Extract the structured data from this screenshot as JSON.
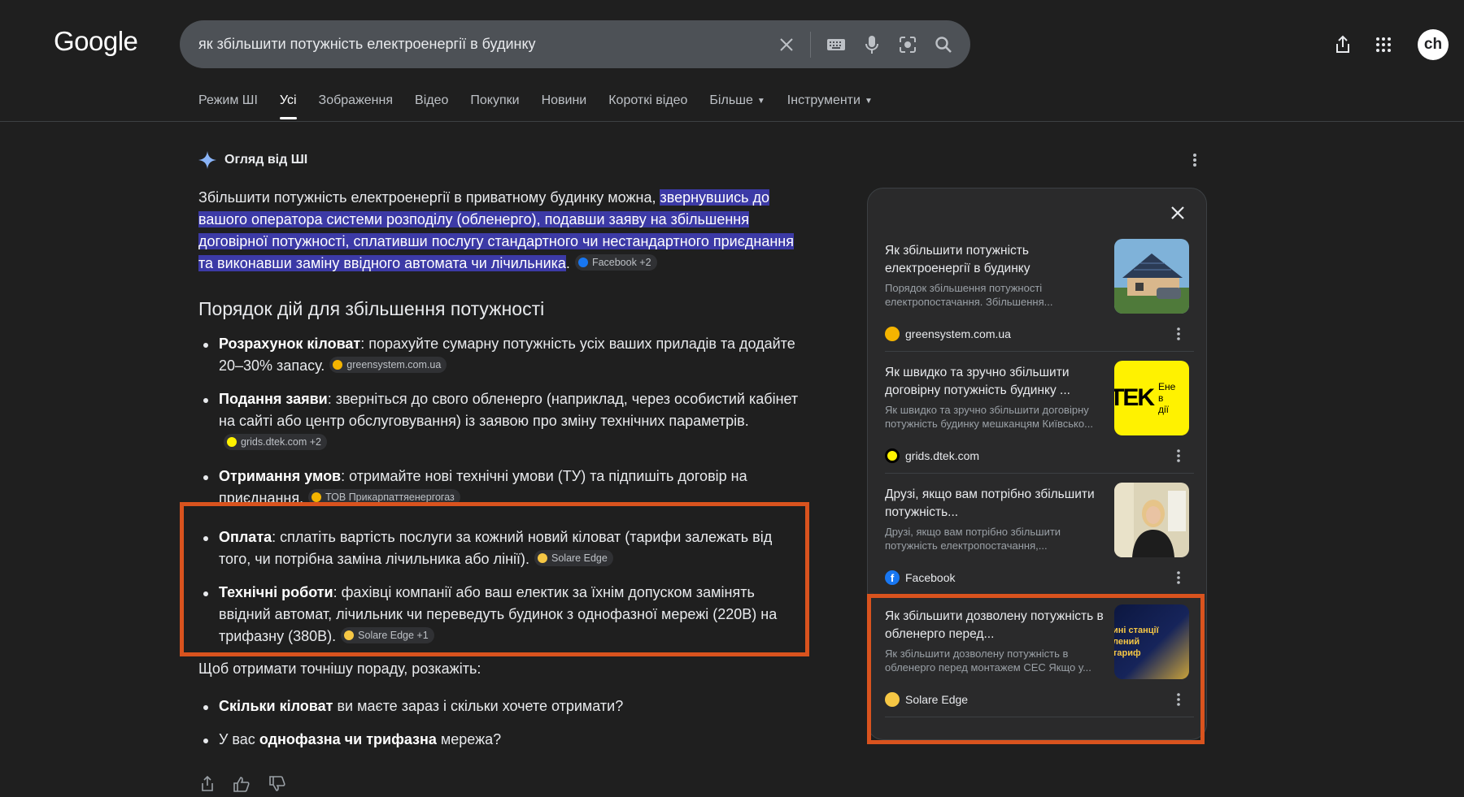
{
  "header": {
    "logo": "Google",
    "query": "як збільшити потужність електроенергії в будинку",
    "avatar_text": "ch",
    "icons": [
      "close-icon",
      "keyboard-icon",
      "mic-icon",
      "lens-icon",
      "search-icon",
      "share-icon",
      "apps-icon"
    ]
  },
  "tabs": [
    {
      "label": "Режим ШІ"
    },
    {
      "label": "Усі"
    },
    {
      "label": "Зображення"
    },
    {
      "label": "Відео"
    },
    {
      "label": "Покупки"
    },
    {
      "label": "Новини"
    },
    {
      "label": "Короткі відео"
    },
    {
      "label": "Більше"
    },
    {
      "label": "Інструменти"
    }
  ],
  "ai": {
    "title": "Огляд від ШІ",
    "intro_plain": "Збільшити потужність електроенергії в приватному будинку можна, ",
    "intro_highlight": "звернувшись до вашого оператора системи розподілу (обленерго), подавши заяву на збільшення договірної потужності, сплативши послугу стандартного чи нестандартного приєднання та виконавши заміну ввідного автомата чи лічильника",
    "intro_end": ".",
    "intro_chip": "Facebook +2",
    "heading": "Порядок дій для збільшення потужності",
    "steps": [
      {
        "bold": "Розрахунок кіловат",
        "text": ": порахуйте сумарну потужність усіх ваших приладів та додайте 20–30% запасу.",
        "chip": "greensystem.com.ua"
      },
      {
        "bold": "Подання заяви",
        "text": ": зверніться до свого обленерго (наприклад, через особистий кабінет на сайті або центр обслуговування) із заявою про зміну технічних параметрів.",
        "chip": "grids.dtek.com +2"
      },
      {
        "bold": "Отримання умов",
        "text": ": отримайте нові технічні умови (ТУ) та підпишіть договір на приєднання.",
        "chip": "ТОВ Прикарпаттяенергогаз"
      },
      {
        "bold": "Оплата",
        "text": ": сплатіть вартість послуги за кожний новий кіловат (тарифи залежать від того, чи потрібна заміна лічильника або лінії).",
        "chip": "Solare Edge"
      },
      {
        "bold": "Технічні роботи",
        "text": ": фахівці компанії або ваш електик за їхнім допуском замінять ввідний автомат, лічильник чи переведуть будинок з однофазної мережі (220В) на трифазну (380В).",
        "chip": "Solare Edge +1"
      }
    ],
    "ask": "Щоб отримати точнішу пораду, розкажіть:",
    "questions": [
      {
        "bold": "Скільки кіловат",
        "pre": "",
        "text": " ви маєте зараз і скільки хочете отримати?"
      },
      {
        "bold": "однофазна чи трифазна",
        "pre": "У вас ",
        "text": " мережа?"
      }
    ]
  },
  "sources": [
    {
      "title": "Як збільшити потужність електроенергії в будинку",
      "desc": "Порядок збільшення потужності електропостачання. Збільшення...",
      "site": "greensystem.com.ua"
    },
    {
      "title": "Як швидко та зручно збільшити договірну потужність будинку ...",
      "desc": "Як швидко та зручно збільшити договірну потужність будинку мешканцям Київсько...",
      "site": "grids.dtek.com",
      "thumb_text": "ТEK",
      "thumb_side": "Енер в дії"
    },
    {
      "title": "Друзі, якщо вам потрібно збільшити потужність...",
      "desc": "Друзі, якщо вам потрібно збільшити потужність електропостачання,...",
      "site": "Facebook"
    },
    {
      "title": "Як збільшити дозволену потужність в обленерго перед...",
      "desc": "Як збільшити дозволену потужність в обленерго перед монтажем СЕС Якщо у...",
      "site": "Solare Edge",
      "thumb_text": "ині станції лений тариф"
    }
  ],
  "colors": {
    "highlight": "#3c3aa6",
    "annotation": "#d9531e",
    "panel": "#2a2a2b"
  }
}
